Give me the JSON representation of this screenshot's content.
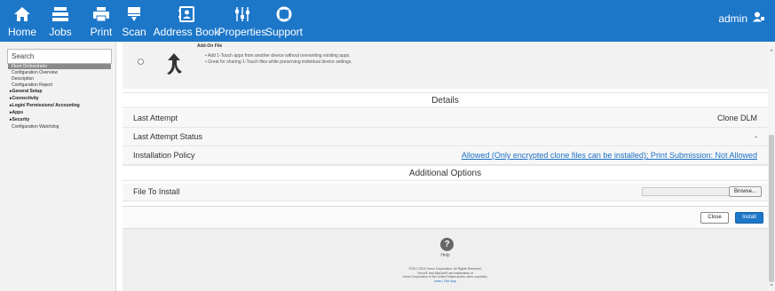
{
  "nav": {
    "items": [
      {
        "label": "Home",
        "icon": "home-icon"
      },
      {
        "label": "Jobs",
        "icon": "jobs-icon"
      },
      {
        "label": "Print",
        "icon": "print-icon"
      },
      {
        "label": "Scan",
        "icon": "scan-icon"
      },
      {
        "label": "Address Book",
        "icon": "address-book-icon"
      },
      {
        "label": "Properties",
        "icon": "properties-icon"
      },
      {
        "label": "Support",
        "icon": "support-icon"
      }
    ],
    "user": "admin",
    "bar_color": "#1d77c9"
  },
  "sidebar": {
    "search_placeholder": "Search",
    "items": [
      {
        "label": "Fleet Orchestrator",
        "active": true
      },
      {
        "label": "Configuration Overview"
      },
      {
        "label": "Description"
      },
      {
        "label": "Configuration Report"
      }
    ],
    "sections": [
      {
        "label": "▸General Setup"
      },
      {
        "label": "▸Connectivity"
      },
      {
        "label": "▸Login/ Permissions/ Accounting"
      },
      {
        "label": "▸Apps"
      },
      {
        "label": "▸Security"
      }
    ],
    "watchdog": "Configuration Watchdog"
  },
  "addon": {
    "title": "Add-On File",
    "bullets": [
      "Add 1-Touch apps from another device without overwriting existing apps.",
      "Great for sharing 1-Touch files while preserving individual device settings."
    ]
  },
  "details": {
    "header": "Details",
    "rows": [
      {
        "label": "Last Attempt",
        "value": "Clone DLM"
      },
      {
        "label": "Last Attempt Status",
        "value": "-"
      },
      {
        "label": "Installation Policy",
        "value": "Allowed (Only encrypted clone files can be installed); Print Submission: Not Allowed"
      }
    ]
  },
  "additional": {
    "header": "Additional Options",
    "file_label": "File To Install",
    "browse_label": "Browse..."
  },
  "buttons": {
    "close": "Close",
    "install": "Install"
  },
  "footer": {
    "help": "Help",
    "copyright_lines": [
      "©2017-2019 Xerox Corporation. All Rights Reserved.",
      "Xerox® and AltaLink® are trademarks of",
      "Xerox Corporation in the United States and/or other countries."
    ],
    "links": "Index | Site Map"
  }
}
